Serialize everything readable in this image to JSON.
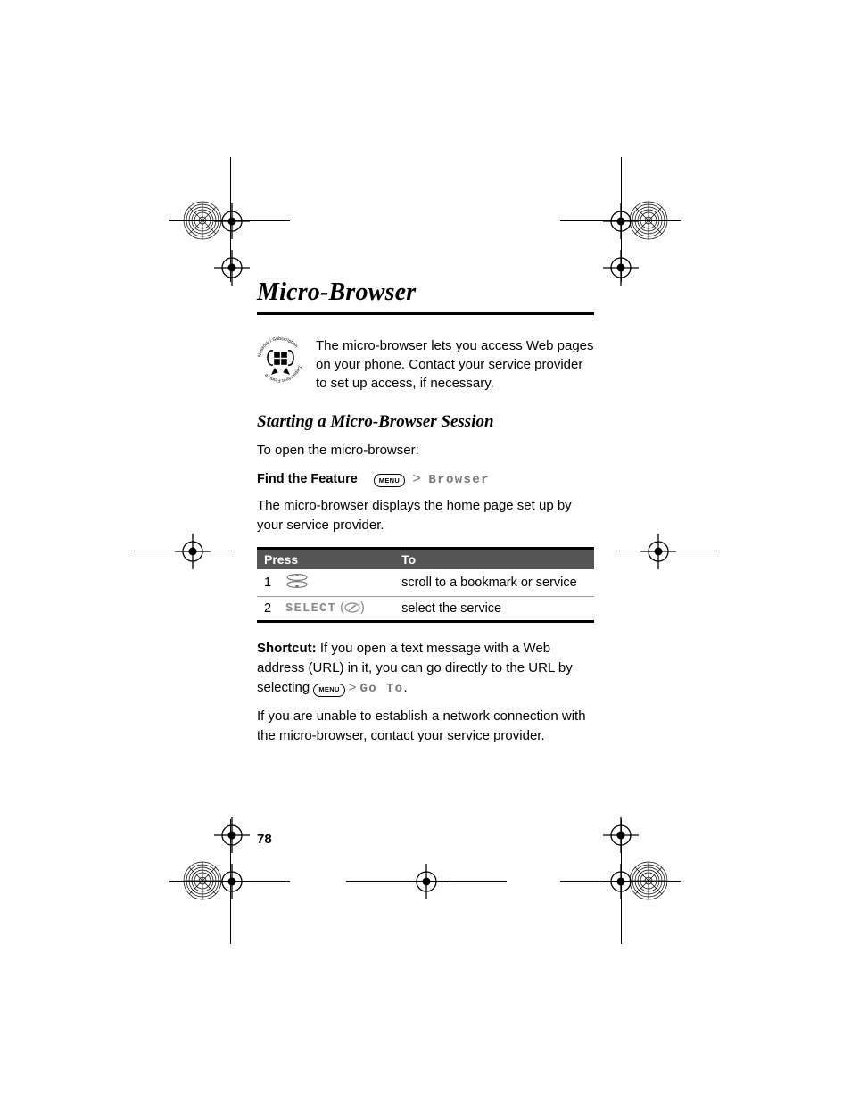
{
  "title": "Micro-Browser",
  "intro": "The micro-browser lets you access Web pages on your phone. Contact your service provider to set up access, if necessary.",
  "subheading": "Starting a Micro-Browser Session",
  "open_line": "To open the micro-browser:",
  "find_the_feature_label": "Find the Feature",
  "menu_chip": "MENU",
  "path_gt": ">",
  "path_browser": "Browser",
  "after_path": "The micro-browser displays the home page set up by your service provider.",
  "table": {
    "headers": {
      "press": "Press",
      "to": "To"
    },
    "rows": [
      {
        "n": "1",
        "press_kind": "nav",
        "to": "scroll to a bookmark or service"
      },
      {
        "n": "2",
        "press_kind": "select",
        "select_label": "SELECT",
        "to": "select the service"
      }
    ]
  },
  "shortcut": {
    "label": "Shortcut:",
    "text_a": " If you open a text message with a Web address (URL) in it, you can go directly to the URL by selecting ",
    "go_to": "Go To",
    "period": "."
  },
  "unable": "If you are unable to establish a network connection with the micro-browser, contact your service provider.",
  "page_number": "78"
}
